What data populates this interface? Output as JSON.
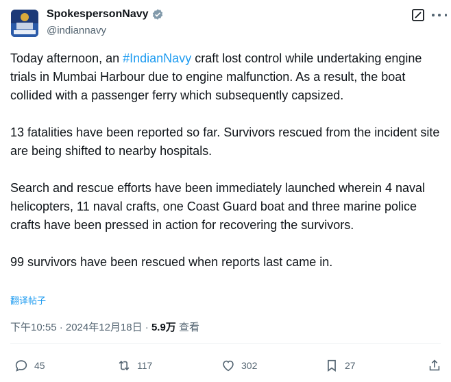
{
  "author": {
    "display_name": "SpokespersonNavy",
    "handle": "@indiannavy"
  },
  "tweet": {
    "p1_before": "Today afternoon, an ",
    "p1_hashtag": "#IndianNavy",
    "p1_after": " craft lost control while undertaking engine trials in Mumbai Harbour due to engine malfunction. As a result, the boat collided with a passenger ferry which subsequently capsized.",
    "p2": "13 fatalities have been reported so far. Survivors rescued from the incident site are being shifted to nearby hospitals.",
    "p3": "Search and rescue efforts have been immediately launched wherein 4 naval helicopters, 11 naval crafts, one Coast Guard boat and three marine police crafts have been pressed in action for recovering the survivors.",
    "p4": "99 survivors have been rescued when reports last came in."
  },
  "translate_label": "翻译帖子",
  "meta": {
    "timestamp": "下午10:55 · 2024年12月18日",
    "separator": " · ",
    "views_count": "5.9万",
    "views_label": " 查看"
  },
  "actions": {
    "reply_count": "45",
    "repost_count": "117",
    "like_count": "302",
    "bookmark_count": "27"
  },
  "icons": [
    "avatar-image",
    "verified-badge-icon",
    "grok-icon",
    "more-icon",
    "reply-icon",
    "repost-icon",
    "like-icon",
    "bookmark-icon",
    "share-icon"
  ],
  "colors": {
    "link": "#1d9bf0",
    "secondary_text": "#536471",
    "primary_text": "#0f1419"
  }
}
